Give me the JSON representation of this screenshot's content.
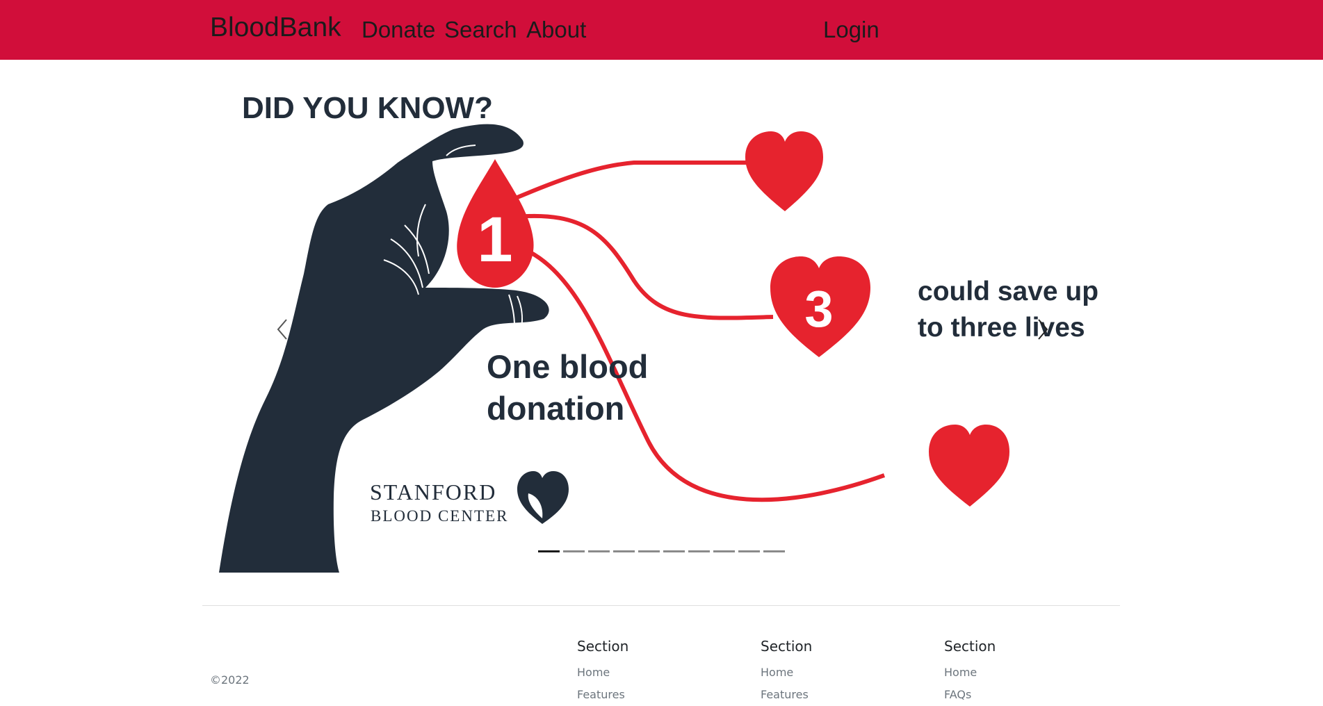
{
  "navbar": {
    "brand": "BloodBank",
    "links": [
      "Donate",
      "Search",
      "About"
    ],
    "login": "Login",
    "background": "#d10e3a"
  },
  "carousel": {
    "slide": {
      "heading": "DID YOU KNOW?",
      "drop_number": "1",
      "heart_number": "3",
      "text_save_line1": "could save up",
      "text_save_line2": "to three lives",
      "text_donation_line1": "One blood",
      "text_donation_line2": "donation",
      "logo_line1": "Stanford",
      "logo_line2": "Blood Center"
    },
    "indicator_count": 10,
    "active_indicator": 0,
    "colors": {
      "red": "#e6232e",
      "dark": "#222d3a"
    }
  },
  "footer": {
    "copyright": "©2022",
    "columns": [
      {
        "title": "Section",
        "links": [
          "Home",
          "Features"
        ]
      },
      {
        "title": "Section",
        "links": [
          "Home",
          "Features"
        ]
      },
      {
        "title": "Section",
        "links": [
          "Home",
          "FAQs"
        ]
      }
    ]
  }
}
